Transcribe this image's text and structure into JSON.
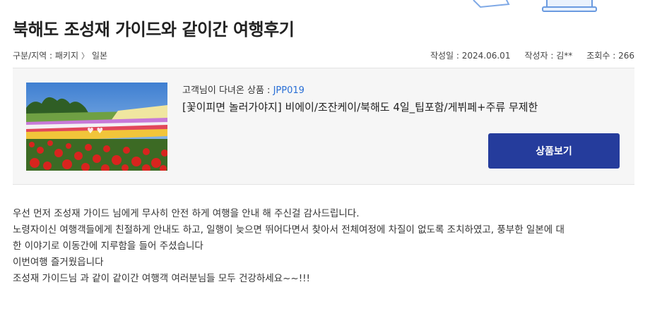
{
  "post": {
    "title": "북해도 조성재 가이드와 같이간 여행후기",
    "breadcrumb": {
      "prefix": "구분/지역 : 패키지",
      "separator": "〉",
      "region": "일본"
    },
    "date": "작성일 : 2024.06.01",
    "author": "작성자 : 김**",
    "views": "조회수 : 266"
  },
  "product": {
    "label_prefix": "고객님이 다녀온 상품 : ",
    "code": "JPP019",
    "name": "[꽃이피면 놀러가야지] 비에이/조잔케이/북해도 4일_팁포함/게뷔페+주류 무제한",
    "button_label": "상품보기",
    "image_icon": "flower-field-photo",
    "accent_color": "#253c9c",
    "code_color": "#2a6fd6"
  },
  "body": {
    "lines": [
      "우선 먼저 조성재 가이드 님에게 무사히  안전 하게 여행을 안내 해 주신걸  감사드립니다.",
      "노령자이신 여행객들에게 친절하게 안내도 하고, 일행이 늦으면 뛰어다면서 찾아서  전체여정에 차질이 없도록 조치하였고, 풍부한 일본에 대",
      "한 이야기로 이동간에  지루함을 들어 주셨습니다",
      "이번여행 즐거웠읍니다",
      "조성재 가이드님 과 같이 같이간 여행객 여러분님들 모두 건강하세요~~!!!"
    ]
  }
}
